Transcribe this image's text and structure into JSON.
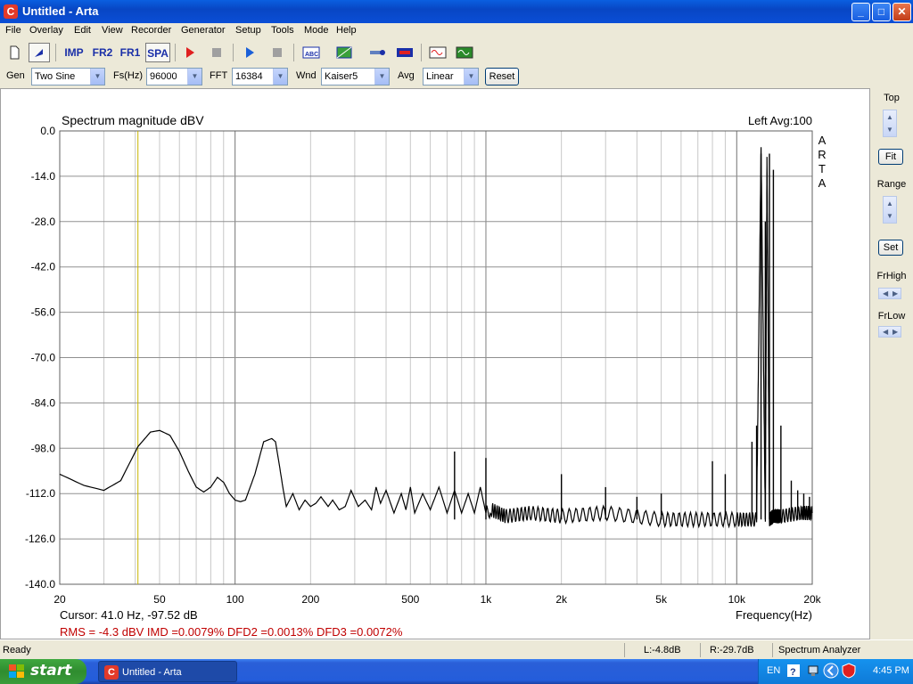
{
  "window": {
    "title": "Untitled - Arta",
    "app_icon": "C"
  },
  "window_controls": {
    "minimize": "_",
    "maximize": "□",
    "close": "✕"
  },
  "menu": [
    "File",
    "Overlay",
    "Edit",
    "View",
    "Recorder",
    "Generator",
    "Setup",
    "Tools",
    "Mode",
    "Help"
  ],
  "toolbar": {
    "imp": "IMP",
    "fr2": "FR2",
    "fr1": "FR1",
    "spa": "SPA"
  },
  "controls": {
    "gen_label": "Gen",
    "gen_value": "Two Sine",
    "fs_label": "Fs(Hz)",
    "fs_value": "96000",
    "fft_label": "FFT",
    "fft_value": "16384",
    "wnd_label": "Wnd",
    "wnd_value": "Kaiser5",
    "avg_label": "Avg",
    "avg_value": "Linear",
    "reset_label": "Reset"
  },
  "right_panel": {
    "top_label": "Top",
    "fit_label": "Fit",
    "range_label": "Range",
    "set_label": "Set",
    "frhigh_label": "FrHigh",
    "frlow_label": "FrLow"
  },
  "status": {
    "ready": "Ready",
    "left_level": "L:-4.8dB",
    "right_level": "R:-29.7dB",
    "mode": "Spectrum Analyzer"
  },
  "taskbar": {
    "start_label": "start",
    "task_title": "Untitled - Arta",
    "lang": "EN",
    "time": "4:45 PM"
  },
  "chart_data": {
    "type": "line",
    "title": "Spectrum magnitude dBV",
    "channel_info": "Left  Avg:100",
    "brand_vertical": [
      "A",
      "R",
      "T",
      "A"
    ],
    "xlabel": "Frequency(Hz)",
    "x_scale": "log",
    "xlim": [
      20,
      20000
    ],
    "ylim": [
      -140,
      0
    ],
    "x_ticks": [
      20,
      50,
      100,
      200,
      500,
      1000,
      2000,
      5000,
      10000,
      20000
    ],
    "x_tick_labels": [
      "20",
      "50",
      "100",
      "200",
      "500",
      "1k",
      "2k",
      "5k",
      "10k",
      "20k"
    ],
    "y_ticks": [
      0,
      -14,
      -28,
      -42,
      -56,
      -70,
      -84,
      -98,
      -112,
      -126,
      -140
    ],
    "y_tick_labels": [
      "0.0",
      "-14.0",
      "-28.0",
      "-42.0",
      "-56.0",
      "-70.0",
      "-84.0",
      "-98.0",
      "-112.0",
      "-126.0",
      "-140.0"
    ],
    "grid": true,
    "cursor": {
      "freq_hz": 41.0,
      "level_db": -97.52,
      "text": "Cursor:    41.0 Hz, -97.52 dB"
    },
    "measurements_text": "RMS =   -4.3 dBV   IMD =0.0079%  DFD2 =0.0013%  DFD3 =0.0072%",
    "series": [
      {
        "x": [
          20,
          25,
          30,
          35,
          41,
          46,
          50,
          55,
          60,
          65,
          70,
          75,
          80,
          85,
          90,
          95,
          100,
          105,
          110,
          120,
          130,
          140,
          145,
          150,
          155,
          160,
          170,
          180,
          190,
          200,
          210,
          220,
          235,
          245,
          260,
          275,
          290,
          310,
          330,
          350,
          365,
          380,
          400,
          430,
          460,
          480,
          500,
          520,
          560,
          600,
          650,
          700,
          750,
          800,
          850,
          900,
          950,
          1000,
          1050,
          1200,
          1500,
          2000,
          3000,
          5000,
          7000,
          10000,
          12000,
          12500,
          13000,
          13200,
          13500,
          14000,
          15000,
          18000,
          20000
        ],
        "y": [
          -106,
          -109.5,
          -111,
          -108,
          -97.5,
          -93,
          -92.5,
          -94,
          -99,
          -105,
          -110,
          -111.5,
          -110,
          -107,
          -108.5,
          -112,
          -114,
          -114.5,
          -114,
          -106,
          -96,
          -95,
          -96,
          -103,
          -110,
          -116,
          -112,
          -117,
          -114,
          -116,
          -115,
          -113,
          -116,
          -114,
          -117,
          -116,
          -111,
          -116,
          -114,
          -117,
          -110,
          -115,
          -111,
          -118,
          -112,
          -117,
          -110,
          -118,
          -112,
          -117,
          -110,
          -118,
          -111,
          -118,
          -112,
          -118,
          -110,
          -118,
          -117,
          -119,
          -118,
          -119,
          -118,
          -120,
          -120,
          -120,
          -120,
          -5,
          -120,
          -8,
          -120,
          -119,
          -119,
          -118,
          -118
        ]
      }
    ],
    "spikes": [
      {
        "freq_hz": 13000,
        "level_db": -28
      },
      {
        "freq_hz": 12500,
        "level_db": -7
      },
      {
        "freq_hz": 13500,
        "level_db": -7
      },
      {
        "freq_hz": 14000,
        "level_db": -12
      },
      {
        "freq_hz": 12000,
        "level_db": -91
      },
      {
        "freq_hz": 15000,
        "level_db": -91
      },
      {
        "freq_hz": 11500,
        "level_db": -96
      },
      {
        "freq_hz": 8000,
        "level_db": -102
      },
      {
        "freq_hz": 9000,
        "level_db": -106
      },
      {
        "freq_hz": 16500,
        "level_db": -108
      },
      {
        "freq_hz": 17500,
        "level_db": -111
      },
      {
        "freq_hz": 18500,
        "level_db": -112
      },
      {
        "freq_hz": 19500,
        "level_db": -113
      },
      {
        "freq_hz": 1000,
        "level_db": -101
      },
      {
        "freq_hz": 750,
        "level_db": -99
      },
      {
        "freq_hz": 2000,
        "level_db": -106
      },
      {
        "freq_hz": 3000,
        "level_db": -110
      },
      {
        "freq_hz": 4000,
        "level_db": -113
      },
      {
        "freq_hz": 5000,
        "level_db": -112
      }
    ]
  }
}
